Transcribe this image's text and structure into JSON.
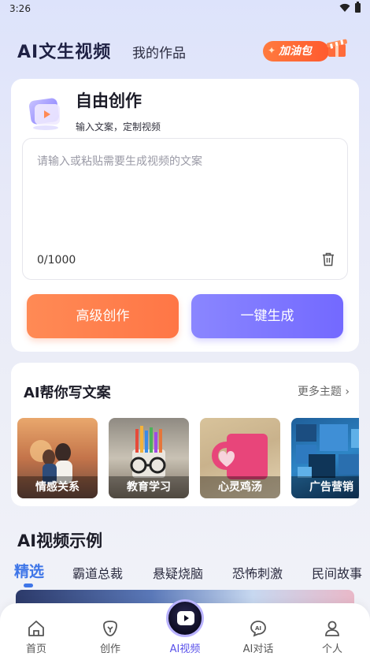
{
  "status_bar": {
    "time": "3:26"
  },
  "header": {
    "app_title": "AI文生视频",
    "my_works_tab": "我的作品",
    "boost_label": "加油包"
  },
  "create": {
    "title": "自由创作",
    "subtitle": "输入文案，定制视频",
    "placeholder": "请输入或粘贴需要生成视频的文案",
    "char_count": "0/1000",
    "advanced_button": "高级创作",
    "generate_button": "一键生成"
  },
  "copywriting": {
    "title": "AI帮你写文案",
    "more_label": "更多主题 ›",
    "topics": [
      {
        "label": "情感关系"
      },
      {
        "label": "教育学习"
      },
      {
        "label": "心灵鸡汤"
      },
      {
        "label": "广告营销"
      }
    ]
  },
  "examples": {
    "title": "AI视频示例",
    "tabs": [
      "精选",
      "霸道总裁",
      "悬疑烧脑",
      "恐怖刺激",
      "民间故事"
    ],
    "active_tab": "精选"
  },
  "bottom_nav": {
    "items": [
      {
        "label": "首页",
        "icon": "home-icon"
      },
      {
        "label": "创作",
        "icon": "create-icon"
      },
      {
        "label": "AI视频",
        "icon": "ai-video-icon"
      },
      {
        "label": "AI对话",
        "icon": "ai-chat-icon"
      },
      {
        "label": "个人",
        "icon": "profile-icon"
      }
    ],
    "active": "AI视频"
  },
  "colors": {
    "accent_orange": "#ff7a4a",
    "accent_purple": "#7a72ff",
    "active_tab_blue": "#3f76e8"
  }
}
